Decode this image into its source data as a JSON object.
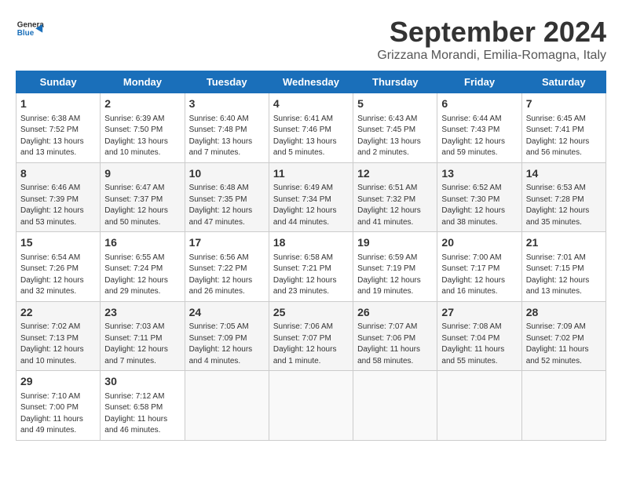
{
  "logo": {
    "line1": "General",
    "line2": "Blue"
  },
  "title": "September 2024",
  "subtitle": "Grizzana Morandi, Emilia-Romagna, Italy",
  "weekdays": [
    "Sunday",
    "Monday",
    "Tuesday",
    "Wednesday",
    "Thursday",
    "Friday",
    "Saturday"
  ],
  "weeks": [
    [
      {
        "day": "1",
        "info": "Sunrise: 6:38 AM\nSunset: 7:52 PM\nDaylight: 13 hours\nand 13 minutes."
      },
      {
        "day": "2",
        "info": "Sunrise: 6:39 AM\nSunset: 7:50 PM\nDaylight: 13 hours\nand 10 minutes."
      },
      {
        "day": "3",
        "info": "Sunrise: 6:40 AM\nSunset: 7:48 PM\nDaylight: 13 hours\nand 7 minutes."
      },
      {
        "day": "4",
        "info": "Sunrise: 6:41 AM\nSunset: 7:46 PM\nDaylight: 13 hours\nand 5 minutes."
      },
      {
        "day": "5",
        "info": "Sunrise: 6:43 AM\nSunset: 7:45 PM\nDaylight: 13 hours\nand 2 minutes."
      },
      {
        "day": "6",
        "info": "Sunrise: 6:44 AM\nSunset: 7:43 PM\nDaylight: 12 hours\nand 59 minutes."
      },
      {
        "day": "7",
        "info": "Sunrise: 6:45 AM\nSunset: 7:41 PM\nDaylight: 12 hours\nand 56 minutes."
      }
    ],
    [
      {
        "day": "8",
        "info": "Sunrise: 6:46 AM\nSunset: 7:39 PM\nDaylight: 12 hours\nand 53 minutes."
      },
      {
        "day": "9",
        "info": "Sunrise: 6:47 AM\nSunset: 7:37 PM\nDaylight: 12 hours\nand 50 minutes."
      },
      {
        "day": "10",
        "info": "Sunrise: 6:48 AM\nSunset: 7:35 PM\nDaylight: 12 hours\nand 47 minutes."
      },
      {
        "day": "11",
        "info": "Sunrise: 6:49 AM\nSunset: 7:34 PM\nDaylight: 12 hours\nand 44 minutes."
      },
      {
        "day": "12",
        "info": "Sunrise: 6:51 AM\nSunset: 7:32 PM\nDaylight: 12 hours\nand 41 minutes."
      },
      {
        "day": "13",
        "info": "Sunrise: 6:52 AM\nSunset: 7:30 PM\nDaylight: 12 hours\nand 38 minutes."
      },
      {
        "day": "14",
        "info": "Sunrise: 6:53 AM\nSunset: 7:28 PM\nDaylight: 12 hours\nand 35 minutes."
      }
    ],
    [
      {
        "day": "15",
        "info": "Sunrise: 6:54 AM\nSunset: 7:26 PM\nDaylight: 12 hours\nand 32 minutes."
      },
      {
        "day": "16",
        "info": "Sunrise: 6:55 AM\nSunset: 7:24 PM\nDaylight: 12 hours\nand 29 minutes."
      },
      {
        "day": "17",
        "info": "Sunrise: 6:56 AM\nSunset: 7:22 PM\nDaylight: 12 hours\nand 26 minutes."
      },
      {
        "day": "18",
        "info": "Sunrise: 6:58 AM\nSunset: 7:21 PM\nDaylight: 12 hours\nand 23 minutes."
      },
      {
        "day": "19",
        "info": "Sunrise: 6:59 AM\nSunset: 7:19 PM\nDaylight: 12 hours\nand 19 minutes."
      },
      {
        "day": "20",
        "info": "Sunrise: 7:00 AM\nSunset: 7:17 PM\nDaylight: 12 hours\nand 16 minutes."
      },
      {
        "day": "21",
        "info": "Sunrise: 7:01 AM\nSunset: 7:15 PM\nDaylight: 12 hours\nand 13 minutes."
      }
    ],
    [
      {
        "day": "22",
        "info": "Sunrise: 7:02 AM\nSunset: 7:13 PM\nDaylight: 12 hours\nand 10 minutes."
      },
      {
        "day": "23",
        "info": "Sunrise: 7:03 AM\nSunset: 7:11 PM\nDaylight: 12 hours\nand 7 minutes."
      },
      {
        "day": "24",
        "info": "Sunrise: 7:05 AM\nSunset: 7:09 PM\nDaylight: 12 hours\nand 4 minutes."
      },
      {
        "day": "25",
        "info": "Sunrise: 7:06 AM\nSunset: 7:07 PM\nDaylight: 12 hours\nand 1 minute."
      },
      {
        "day": "26",
        "info": "Sunrise: 7:07 AM\nSunset: 7:06 PM\nDaylight: 11 hours\nand 58 minutes."
      },
      {
        "day": "27",
        "info": "Sunrise: 7:08 AM\nSunset: 7:04 PM\nDaylight: 11 hours\nand 55 minutes."
      },
      {
        "day": "28",
        "info": "Sunrise: 7:09 AM\nSunset: 7:02 PM\nDaylight: 11 hours\nand 52 minutes."
      }
    ],
    [
      {
        "day": "29",
        "info": "Sunrise: 7:10 AM\nSunset: 7:00 PM\nDaylight: 11 hours\nand 49 minutes."
      },
      {
        "day": "30",
        "info": "Sunrise: 7:12 AM\nSunset: 6:58 PM\nDaylight: 11 hours\nand 46 minutes."
      },
      {
        "day": "",
        "info": ""
      },
      {
        "day": "",
        "info": ""
      },
      {
        "day": "",
        "info": ""
      },
      {
        "day": "",
        "info": ""
      },
      {
        "day": "",
        "info": ""
      }
    ]
  ]
}
